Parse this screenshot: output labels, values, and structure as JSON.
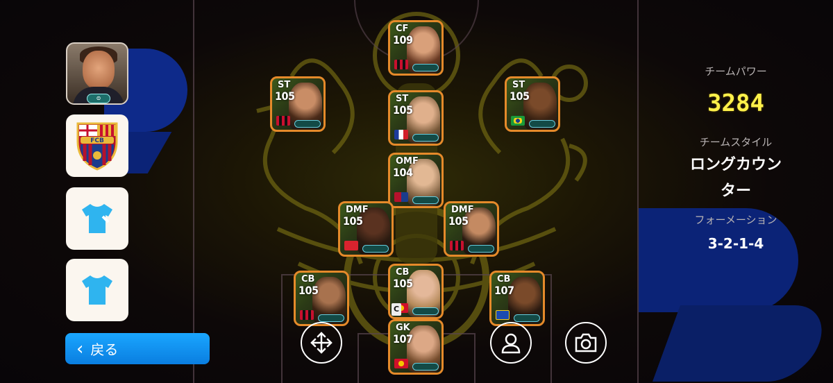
{
  "panel": {
    "team_power_label": "チームパワー",
    "team_power_value": "3284",
    "team_style_label": "チームスタイル",
    "team_style_value_line1": "ロングカウン",
    "team_style_value_line2": "ター",
    "formation_label": "フォーメーション",
    "formation_value": "3-2-1-4"
  },
  "sidebar": {
    "back_label": "戻る",
    "club_crest_text": "FCB"
  },
  "players": [
    {
      "pos": "CF",
      "ovr": "109",
      "flag": "milan"
    },
    {
      "pos": "ST",
      "ovr": "105",
      "flag": "milan"
    },
    {
      "pos": "ST",
      "ovr": "105",
      "flag": "france"
    },
    {
      "pos": "ST",
      "ovr": "105",
      "flag": "brazil"
    },
    {
      "pos": "OMF",
      "ovr": "104",
      "flag": "barcelona"
    },
    {
      "pos": "DMF",
      "ovr": "105",
      "flag": "arsenal"
    },
    {
      "pos": "DMF",
      "ovr": "105",
      "flag": "milan"
    },
    {
      "pos": "CB",
      "ovr": "105",
      "flag": "milan"
    },
    {
      "pos": "CB",
      "ovr": "105",
      "flag": "manutd"
    },
    {
      "pos": "CB",
      "ovr": "107",
      "flag": "rangers"
    },
    {
      "pos": "GK",
      "ovr": "107",
      "flag": "manutd"
    }
  ],
  "captain_badge": "C",
  "colors": {
    "accent_blue": "#1aa6ff",
    "power_yellow": "#fff14a",
    "card_border": "#e58a2a"
  },
  "icons": [
    "move-icon",
    "person-icon",
    "camera-icon",
    "shirt-icon",
    "back-chevron-icon"
  ]
}
